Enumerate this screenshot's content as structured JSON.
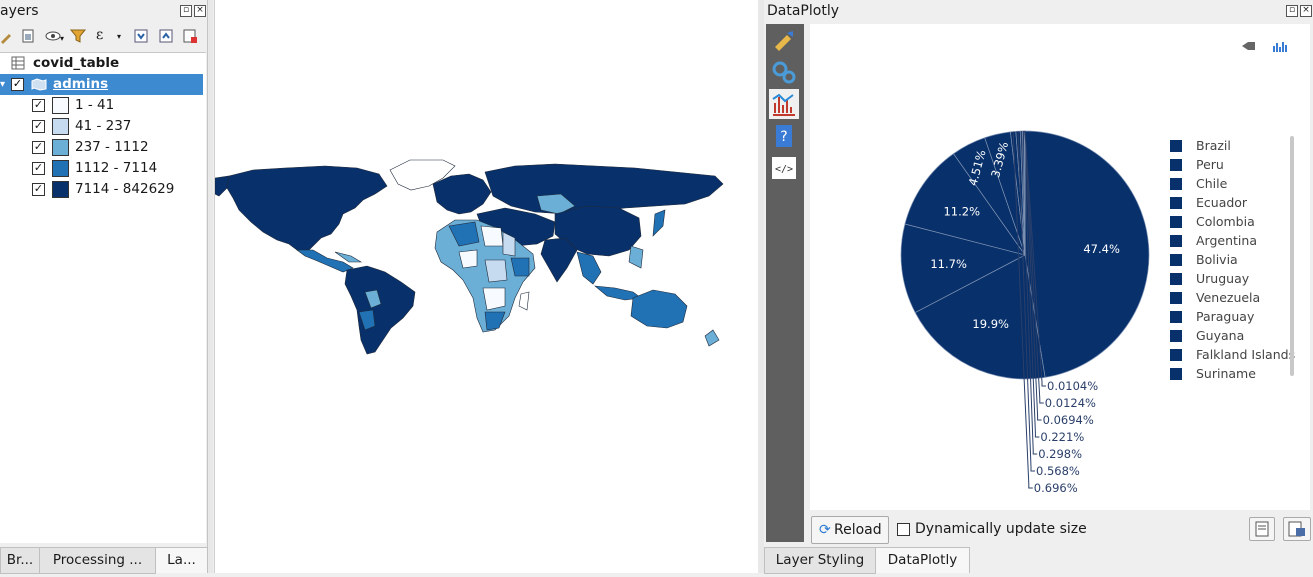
{
  "layers_panel": {
    "title": "ayers",
    "items": [
      {
        "label": "covid_table",
        "type": "table"
      },
      {
        "label": "admins",
        "type": "polygon",
        "checked": true
      }
    ],
    "classes": [
      {
        "label": "1 - 41",
        "color": "#f7fbff"
      },
      {
        "label": "41 - 237",
        "color": "#c6dbef"
      },
      {
        "label": "237 - 1112",
        "color": "#6baed6"
      },
      {
        "label": "1112 - 7114",
        "color": "#2171b5"
      },
      {
        "label": "7114 - 842629",
        "color": "#08306b"
      }
    ],
    "bottom_tabs": [
      "Br...",
      "Processing ...",
      "La..."
    ]
  },
  "dataplotly": {
    "title": "DataPlotly",
    "reload_label": "Reload",
    "dynamic_label": "Dynamically update size",
    "tabs": [
      "Layer Styling",
      "DataPlotly"
    ]
  },
  "chart_data": {
    "type": "pie",
    "categories": [
      "Brazil",
      "Peru",
      "Chile",
      "Ecuador",
      "Colombia",
      "Argentina",
      "Bolivia",
      "Uruguay",
      "Venezuela",
      "Paraguay",
      "Guyana",
      "Falkland Islands",
      "Suriname"
    ],
    "slice_labels": [
      "47.4%",
      "19.9%",
      "11.7%",
      "11.2%",
      "4.51%",
      "3.39%",
      "0.696%",
      "0.568%",
      "0.298%",
      "0.221%",
      "0.0694%",
      "0.0124%",
      "0.0104%"
    ],
    "values": [
      47.4,
      19.9,
      11.7,
      11.2,
      4.51,
      3.39,
      0.696,
      0.568,
      0.298,
      0.221,
      0.0694,
      0.0124,
      0.0104
    ],
    "color": "#08306b",
    "legend_position": "right"
  }
}
